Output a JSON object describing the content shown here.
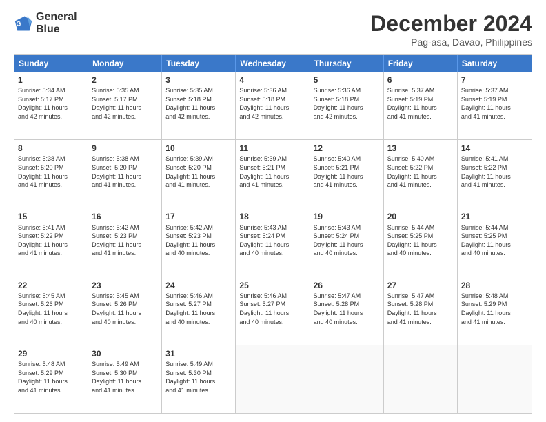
{
  "header": {
    "logo_line1": "General",
    "logo_line2": "Blue",
    "month_title": "December 2024",
    "location": "Pag-asa, Davao, Philippines"
  },
  "calendar": {
    "days_of_week": [
      "Sunday",
      "Monday",
      "Tuesday",
      "Wednesday",
      "Thursday",
      "Friday",
      "Saturday"
    ],
    "rows": [
      [
        {
          "day": "1",
          "info": "Sunrise: 5:34 AM\nSunset: 5:17 PM\nDaylight: 11 hours\nand 42 minutes."
        },
        {
          "day": "2",
          "info": "Sunrise: 5:35 AM\nSunset: 5:17 PM\nDaylight: 11 hours\nand 42 minutes."
        },
        {
          "day": "3",
          "info": "Sunrise: 5:35 AM\nSunset: 5:18 PM\nDaylight: 11 hours\nand 42 minutes."
        },
        {
          "day": "4",
          "info": "Sunrise: 5:36 AM\nSunset: 5:18 PM\nDaylight: 11 hours\nand 42 minutes."
        },
        {
          "day": "5",
          "info": "Sunrise: 5:36 AM\nSunset: 5:18 PM\nDaylight: 11 hours\nand 42 minutes."
        },
        {
          "day": "6",
          "info": "Sunrise: 5:37 AM\nSunset: 5:19 PM\nDaylight: 11 hours\nand 41 minutes."
        },
        {
          "day": "7",
          "info": "Sunrise: 5:37 AM\nSunset: 5:19 PM\nDaylight: 11 hours\nand 41 minutes."
        }
      ],
      [
        {
          "day": "8",
          "info": "Sunrise: 5:38 AM\nSunset: 5:20 PM\nDaylight: 11 hours\nand 41 minutes."
        },
        {
          "day": "9",
          "info": "Sunrise: 5:38 AM\nSunset: 5:20 PM\nDaylight: 11 hours\nand 41 minutes."
        },
        {
          "day": "10",
          "info": "Sunrise: 5:39 AM\nSunset: 5:20 PM\nDaylight: 11 hours\nand 41 minutes."
        },
        {
          "day": "11",
          "info": "Sunrise: 5:39 AM\nSunset: 5:21 PM\nDaylight: 11 hours\nand 41 minutes."
        },
        {
          "day": "12",
          "info": "Sunrise: 5:40 AM\nSunset: 5:21 PM\nDaylight: 11 hours\nand 41 minutes."
        },
        {
          "day": "13",
          "info": "Sunrise: 5:40 AM\nSunset: 5:22 PM\nDaylight: 11 hours\nand 41 minutes."
        },
        {
          "day": "14",
          "info": "Sunrise: 5:41 AM\nSunset: 5:22 PM\nDaylight: 11 hours\nand 41 minutes."
        }
      ],
      [
        {
          "day": "15",
          "info": "Sunrise: 5:41 AM\nSunset: 5:22 PM\nDaylight: 11 hours\nand 41 minutes."
        },
        {
          "day": "16",
          "info": "Sunrise: 5:42 AM\nSunset: 5:23 PM\nDaylight: 11 hours\nand 41 minutes."
        },
        {
          "day": "17",
          "info": "Sunrise: 5:42 AM\nSunset: 5:23 PM\nDaylight: 11 hours\nand 40 minutes."
        },
        {
          "day": "18",
          "info": "Sunrise: 5:43 AM\nSunset: 5:24 PM\nDaylight: 11 hours\nand 40 minutes."
        },
        {
          "day": "19",
          "info": "Sunrise: 5:43 AM\nSunset: 5:24 PM\nDaylight: 11 hours\nand 40 minutes."
        },
        {
          "day": "20",
          "info": "Sunrise: 5:44 AM\nSunset: 5:25 PM\nDaylight: 11 hours\nand 40 minutes."
        },
        {
          "day": "21",
          "info": "Sunrise: 5:44 AM\nSunset: 5:25 PM\nDaylight: 11 hours\nand 40 minutes."
        }
      ],
      [
        {
          "day": "22",
          "info": "Sunrise: 5:45 AM\nSunset: 5:26 PM\nDaylight: 11 hours\nand 40 minutes."
        },
        {
          "day": "23",
          "info": "Sunrise: 5:45 AM\nSunset: 5:26 PM\nDaylight: 11 hours\nand 40 minutes."
        },
        {
          "day": "24",
          "info": "Sunrise: 5:46 AM\nSunset: 5:27 PM\nDaylight: 11 hours\nand 40 minutes."
        },
        {
          "day": "25",
          "info": "Sunrise: 5:46 AM\nSunset: 5:27 PM\nDaylight: 11 hours\nand 40 minutes."
        },
        {
          "day": "26",
          "info": "Sunrise: 5:47 AM\nSunset: 5:28 PM\nDaylight: 11 hours\nand 40 minutes."
        },
        {
          "day": "27",
          "info": "Sunrise: 5:47 AM\nSunset: 5:28 PM\nDaylight: 11 hours\nand 41 minutes."
        },
        {
          "day": "28",
          "info": "Sunrise: 5:48 AM\nSunset: 5:29 PM\nDaylight: 11 hours\nand 41 minutes."
        }
      ],
      [
        {
          "day": "29",
          "info": "Sunrise: 5:48 AM\nSunset: 5:29 PM\nDaylight: 11 hours\nand 41 minutes."
        },
        {
          "day": "30",
          "info": "Sunrise: 5:49 AM\nSunset: 5:30 PM\nDaylight: 11 hours\nand 41 minutes."
        },
        {
          "day": "31",
          "info": "Sunrise: 5:49 AM\nSunset: 5:30 PM\nDaylight: 11 hours\nand 41 minutes."
        },
        {
          "day": "",
          "info": ""
        },
        {
          "day": "",
          "info": ""
        },
        {
          "day": "",
          "info": ""
        },
        {
          "day": "",
          "info": ""
        }
      ]
    ]
  }
}
